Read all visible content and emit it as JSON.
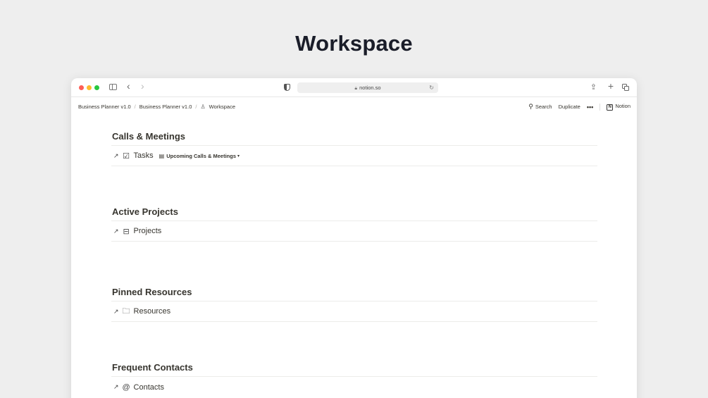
{
  "page": {
    "heading": "Workspace"
  },
  "browser": {
    "url": "notion.so",
    "icons": [
      "sidebar-toggle-icon",
      "back-icon",
      "forward-icon",
      "shield-icon",
      "lock-icon",
      "reload-icon",
      "share-icon",
      "plus-icon",
      "tabs-icon"
    ]
  },
  "notion": {
    "breadcrumb": [
      "Business Planner v1.0",
      "Business Planner v1.0",
      "Workspace"
    ],
    "actions": {
      "search": "Search",
      "duplicate": "Duplicate",
      "more": "•••",
      "notion": "Notion"
    }
  },
  "sections": [
    {
      "title": "Calls & Meetings",
      "db": "Tasks",
      "icon": "checkbox-icon",
      "view": "Upcoming Calls & Meetings"
    },
    {
      "title": "Active Projects",
      "db": "Projects",
      "icon": "database-icon"
    },
    {
      "title": "Pinned Resources",
      "db": "Resources",
      "icon": "folder-icon"
    },
    {
      "title": "Frequent Contacts",
      "db": "Contacts",
      "icon": "at-icon"
    }
  ],
  "colors": {
    "background": "#eeeeee",
    "heading": "#1a1d29",
    "text": "#37352f",
    "red": "#fe5f57",
    "yellow": "#febc2e",
    "green": "#28c840"
  }
}
